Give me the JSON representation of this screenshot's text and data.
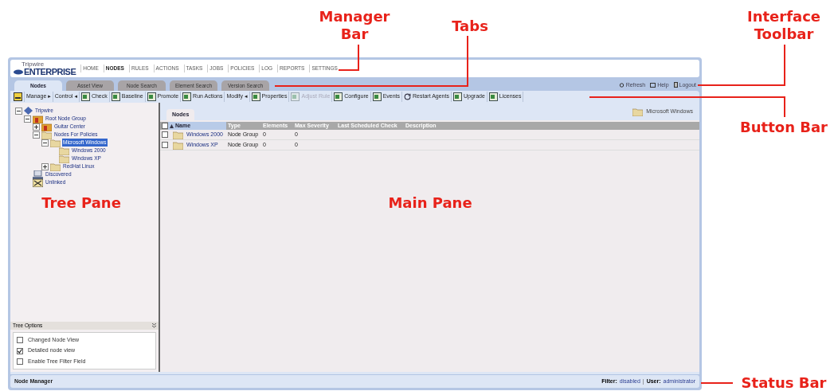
{
  "annotations": [
    {
      "text": "Manager Bar"
    },
    {
      "text": "Tabs"
    },
    {
      "text": "Interface Toolbar"
    },
    {
      "text": "Button Bar"
    },
    {
      "text": "Tree Pane"
    },
    {
      "text": "Main Pane"
    },
    {
      "text": "Status Bar"
    }
  ],
  "manager_bar": {
    "logo_small": "Tripwire",
    "logo": "ENTERPRISE",
    "items": [
      {
        "label": "HOME",
        "selected": false
      },
      {
        "label": "NODES",
        "selected": true
      },
      {
        "label": "RULES",
        "selected": false
      },
      {
        "label": "ACTIONS",
        "selected": false
      },
      {
        "label": "TASKS",
        "selected": false
      },
      {
        "label": "JOBS",
        "selected": false
      },
      {
        "label": "POLICIES",
        "selected": false
      },
      {
        "label": "LOG",
        "selected": false
      },
      {
        "label": "REPORTS",
        "selected": false
      },
      {
        "label": "SETTINGS",
        "selected": false
      }
    ]
  },
  "tabs": [
    {
      "label": "Nodes",
      "selected": true
    },
    {
      "label": "Asset View",
      "selected": false
    },
    {
      "label": "Node Search",
      "selected": false
    },
    {
      "label": "Element Search",
      "selected": false
    },
    {
      "label": "Version Search",
      "selected": false
    }
  ],
  "interface_toolbar": [
    {
      "label": "Refresh",
      "kind": "refresh"
    },
    {
      "label": "Help",
      "kind": "help"
    },
    {
      "label": "Logout",
      "kind": "logout"
    }
  ],
  "button_bar": [
    {
      "kind": "icon"
    },
    {
      "kind": "menu",
      "label": "Manage",
      "arrow": "▸"
    },
    {
      "kind": "menu",
      "label": "Control",
      "arrow": "◂"
    },
    {
      "kind": "button",
      "label": "Check",
      "disabled": false
    },
    {
      "kind": "button",
      "label": "Baseline",
      "disabled": false
    },
    {
      "kind": "button",
      "label": "Promote",
      "disabled": false
    },
    {
      "kind": "button",
      "label": "Run Actions",
      "disabled": false
    },
    {
      "kind": "menu",
      "label": "Modify",
      "arrow": "◂"
    },
    {
      "kind": "button",
      "label": "Properties",
      "disabled": false
    },
    {
      "kind": "button",
      "label": "Adjust Rule",
      "disabled": true
    },
    {
      "kind": "button",
      "label": "Configure",
      "disabled": false
    },
    {
      "kind": "button",
      "label": "Events",
      "disabled": false
    },
    {
      "kind": "restart",
      "label": "Restart Agents",
      "disabled": false
    },
    {
      "kind": "button",
      "label": "Upgrade",
      "disabled": false
    },
    {
      "kind": "button",
      "label": "Licenses",
      "disabled": false
    }
  ],
  "tree": [
    {
      "label": "Tripwire",
      "kind": "root",
      "expanded": true,
      "selected": false,
      "children": [
        {
          "label": "Root Node Group",
          "kind": "group",
          "expanded": true,
          "selected": false,
          "children": [
            {
              "label": "Guitar Center",
              "kind": "group",
              "expanded": false,
              "selected": false
            },
            {
              "label": "Nodes For Policies",
              "kind": "folder",
              "expanded": true,
              "selected": false,
              "children": [
                {
                  "label": "Microsoft Windows",
                  "kind": "folder",
                  "expanded": true,
                  "selected": true,
                  "children": [
                    {
                      "label": "Windows 2000",
                      "kind": "folder",
                      "selected": false
                    },
                    {
                      "label": "Windows XP",
                      "kind": "folder",
                      "selected": false
                    }
                  ]
                },
                {
                  "label": "RedHat Linux",
                  "kind": "folder",
                  "expanded": false,
                  "selected": false
                }
              ]
            }
          ]
        },
        {
          "label": "Discovered",
          "kind": "discovered",
          "selected": false
        },
        {
          "label": "Unlinked",
          "kind": "unlinked",
          "selected": false
        }
      ]
    }
  ],
  "tree_options": {
    "title": "Tree Options",
    "options": [
      {
        "label": "Changed Node View",
        "checked": false
      },
      {
        "label": "Detailed node view",
        "checked": true
      },
      {
        "label": "Enable Tree Filter Field",
        "checked": false
      }
    ]
  },
  "main": {
    "tab": "Nodes",
    "location": "Microsoft Windows",
    "table": {
      "header_checked": false,
      "columns": [
        {
          "label": "Name",
          "sorted": true
        },
        {
          "label": "Type",
          "sorted": false
        },
        {
          "label": "Elements",
          "sorted": false
        },
        {
          "label": "Max Severity",
          "sorted": false
        },
        {
          "label": "Last Scheduled Check",
          "sorted": false
        },
        {
          "label": "Description",
          "sorted": false
        }
      ],
      "rows": [
        {
          "checked": false,
          "cells": [
            "Windows 2000",
            "Node Group",
            "0",
            "0"
          ]
        },
        {
          "checked": false,
          "cells": [
            "Windows XP",
            "Node Group",
            "0",
            "0"
          ]
        }
      ]
    }
  },
  "status_bar": {
    "title": "Node Manager",
    "filter_label": "Filter:",
    "filter": "disabled",
    "separator": "|",
    "user_label": "User:",
    "user": "administrator"
  }
}
